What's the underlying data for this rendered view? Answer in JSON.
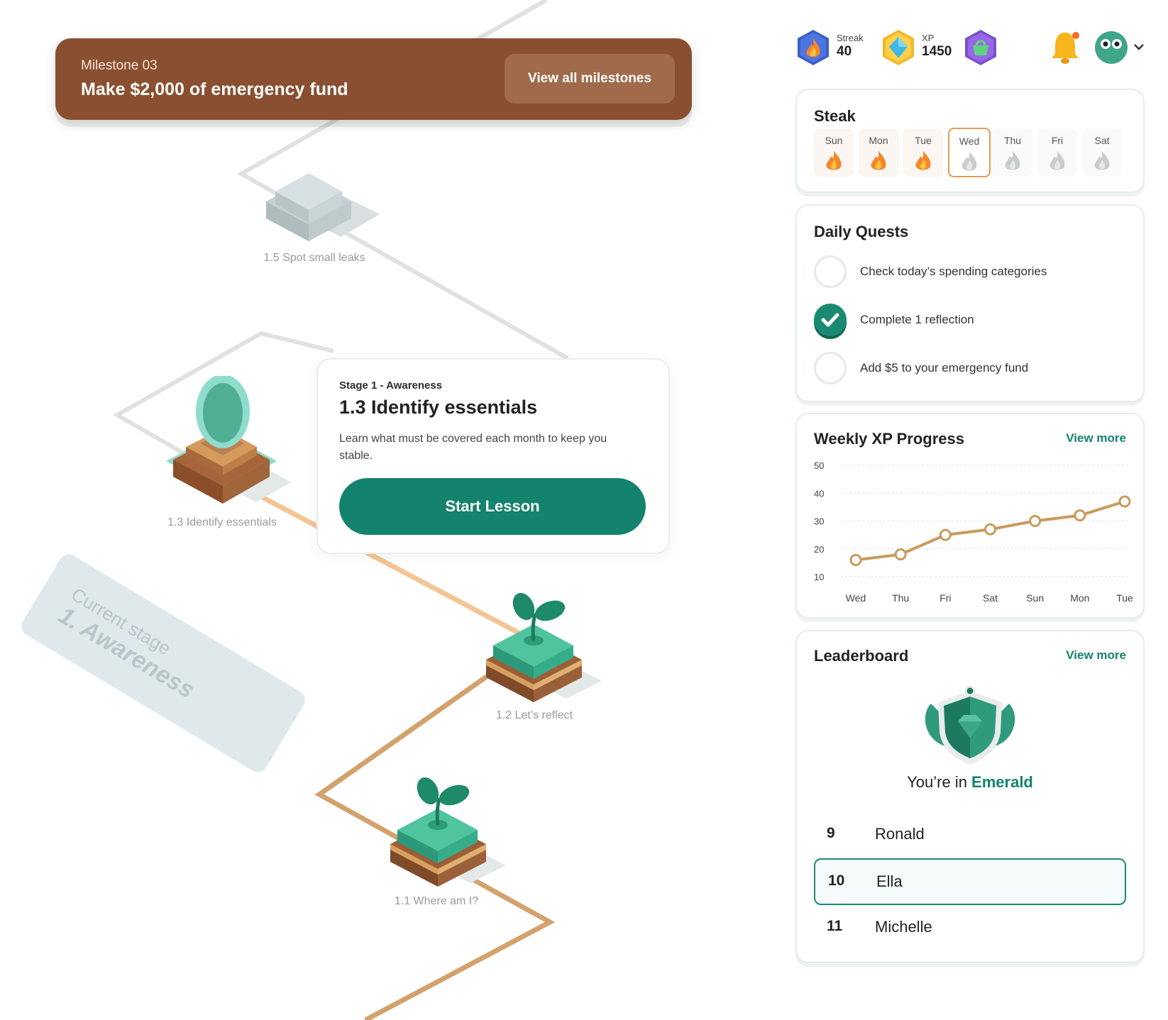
{
  "milestone": {
    "label": "Milestone 03",
    "title": "Make $2,000 of emergency fund",
    "button": "View all milestones"
  },
  "lessons": [
    {
      "label": "1.5 Spot small leaks",
      "state": "locked"
    },
    {
      "label": "1.3 Identify essentials",
      "state": "current"
    },
    {
      "label": "1.2 Let’s reflect",
      "state": "completed"
    },
    {
      "label": "1.1 Where am I?",
      "state": "completed"
    }
  ],
  "lesson_card": {
    "stage": "Stage 1 - Awareness",
    "title": "1.3 Identify essentials",
    "description": "Learn what must be covered each month to keep you stable.",
    "button": "Start Lesson"
  },
  "current_stage": {
    "sub": "Current stage",
    "main": "1. Awareness"
  },
  "topbar": {
    "streak_label": "Streak",
    "streak_value": "40",
    "xp_label": "XP",
    "xp_value": "1450",
    "icons": [
      "fire-badge-icon",
      "diamond-icon",
      "shop-basket-icon",
      "bell-icon",
      "avatar"
    ]
  },
  "streak": {
    "title": "Steak",
    "days": [
      {
        "name": "Sun",
        "done": true
      },
      {
        "name": "Mon",
        "done": true
      },
      {
        "name": "Tue",
        "done": true
      },
      {
        "name": "Wed",
        "done": false,
        "today": true
      },
      {
        "name": "Thu",
        "done": false
      },
      {
        "name": "Fri",
        "done": false
      },
      {
        "name": "Sat",
        "done": false
      }
    ]
  },
  "quests": {
    "title": "Daily Quests",
    "items": [
      {
        "text": "Check today’s spending categories",
        "done": false
      },
      {
        "text": "Complete 1 reflection",
        "done": true
      },
      {
        "text": "Add $5 to your emergency fund",
        "done": false
      }
    ]
  },
  "weekly": {
    "title": "Weekly XP Progress",
    "view_more": "View more"
  },
  "chart_data": {
    "type": "line",
    "categories": [
      "Wed",
      "Thu",
      "Fri",
      "Sat",
      "Sun",
      "Mon",
      "Tue"
    ],
    "values": [
      16,
      18,
      25,
      27,
      30,
      32,
      37
    ],
    "yticks": [
      50,
      40,
      30,
      20,
      10
    ],
    "ylim": [
      10,
      50
    ],
    "grid": true,
    "color": "#c99a5b"
  },
  "leaderboard": {
    "title": "Leaderboard",
    "view_more": "View more",
    "league_prefix": "You’re in ",
    "league_name": "Emerald",
    "rows": [
      {
        "rank": "9",
        "name": "Ronald",
        "me": false
      },
      {
        "rank": "10",
        "name": "Ella",
        "me": true
      },
      {
        "rank": "11",
        "name": "Michelle",
        "me": false
      }
    ]
  },
  "colors": {
    "accent": "#13836d",
    "milestone_bg": "#8a4f30",
    "path_active": "#e8b37a",
    "path_locked": "#d9d9d9"
  }
}
